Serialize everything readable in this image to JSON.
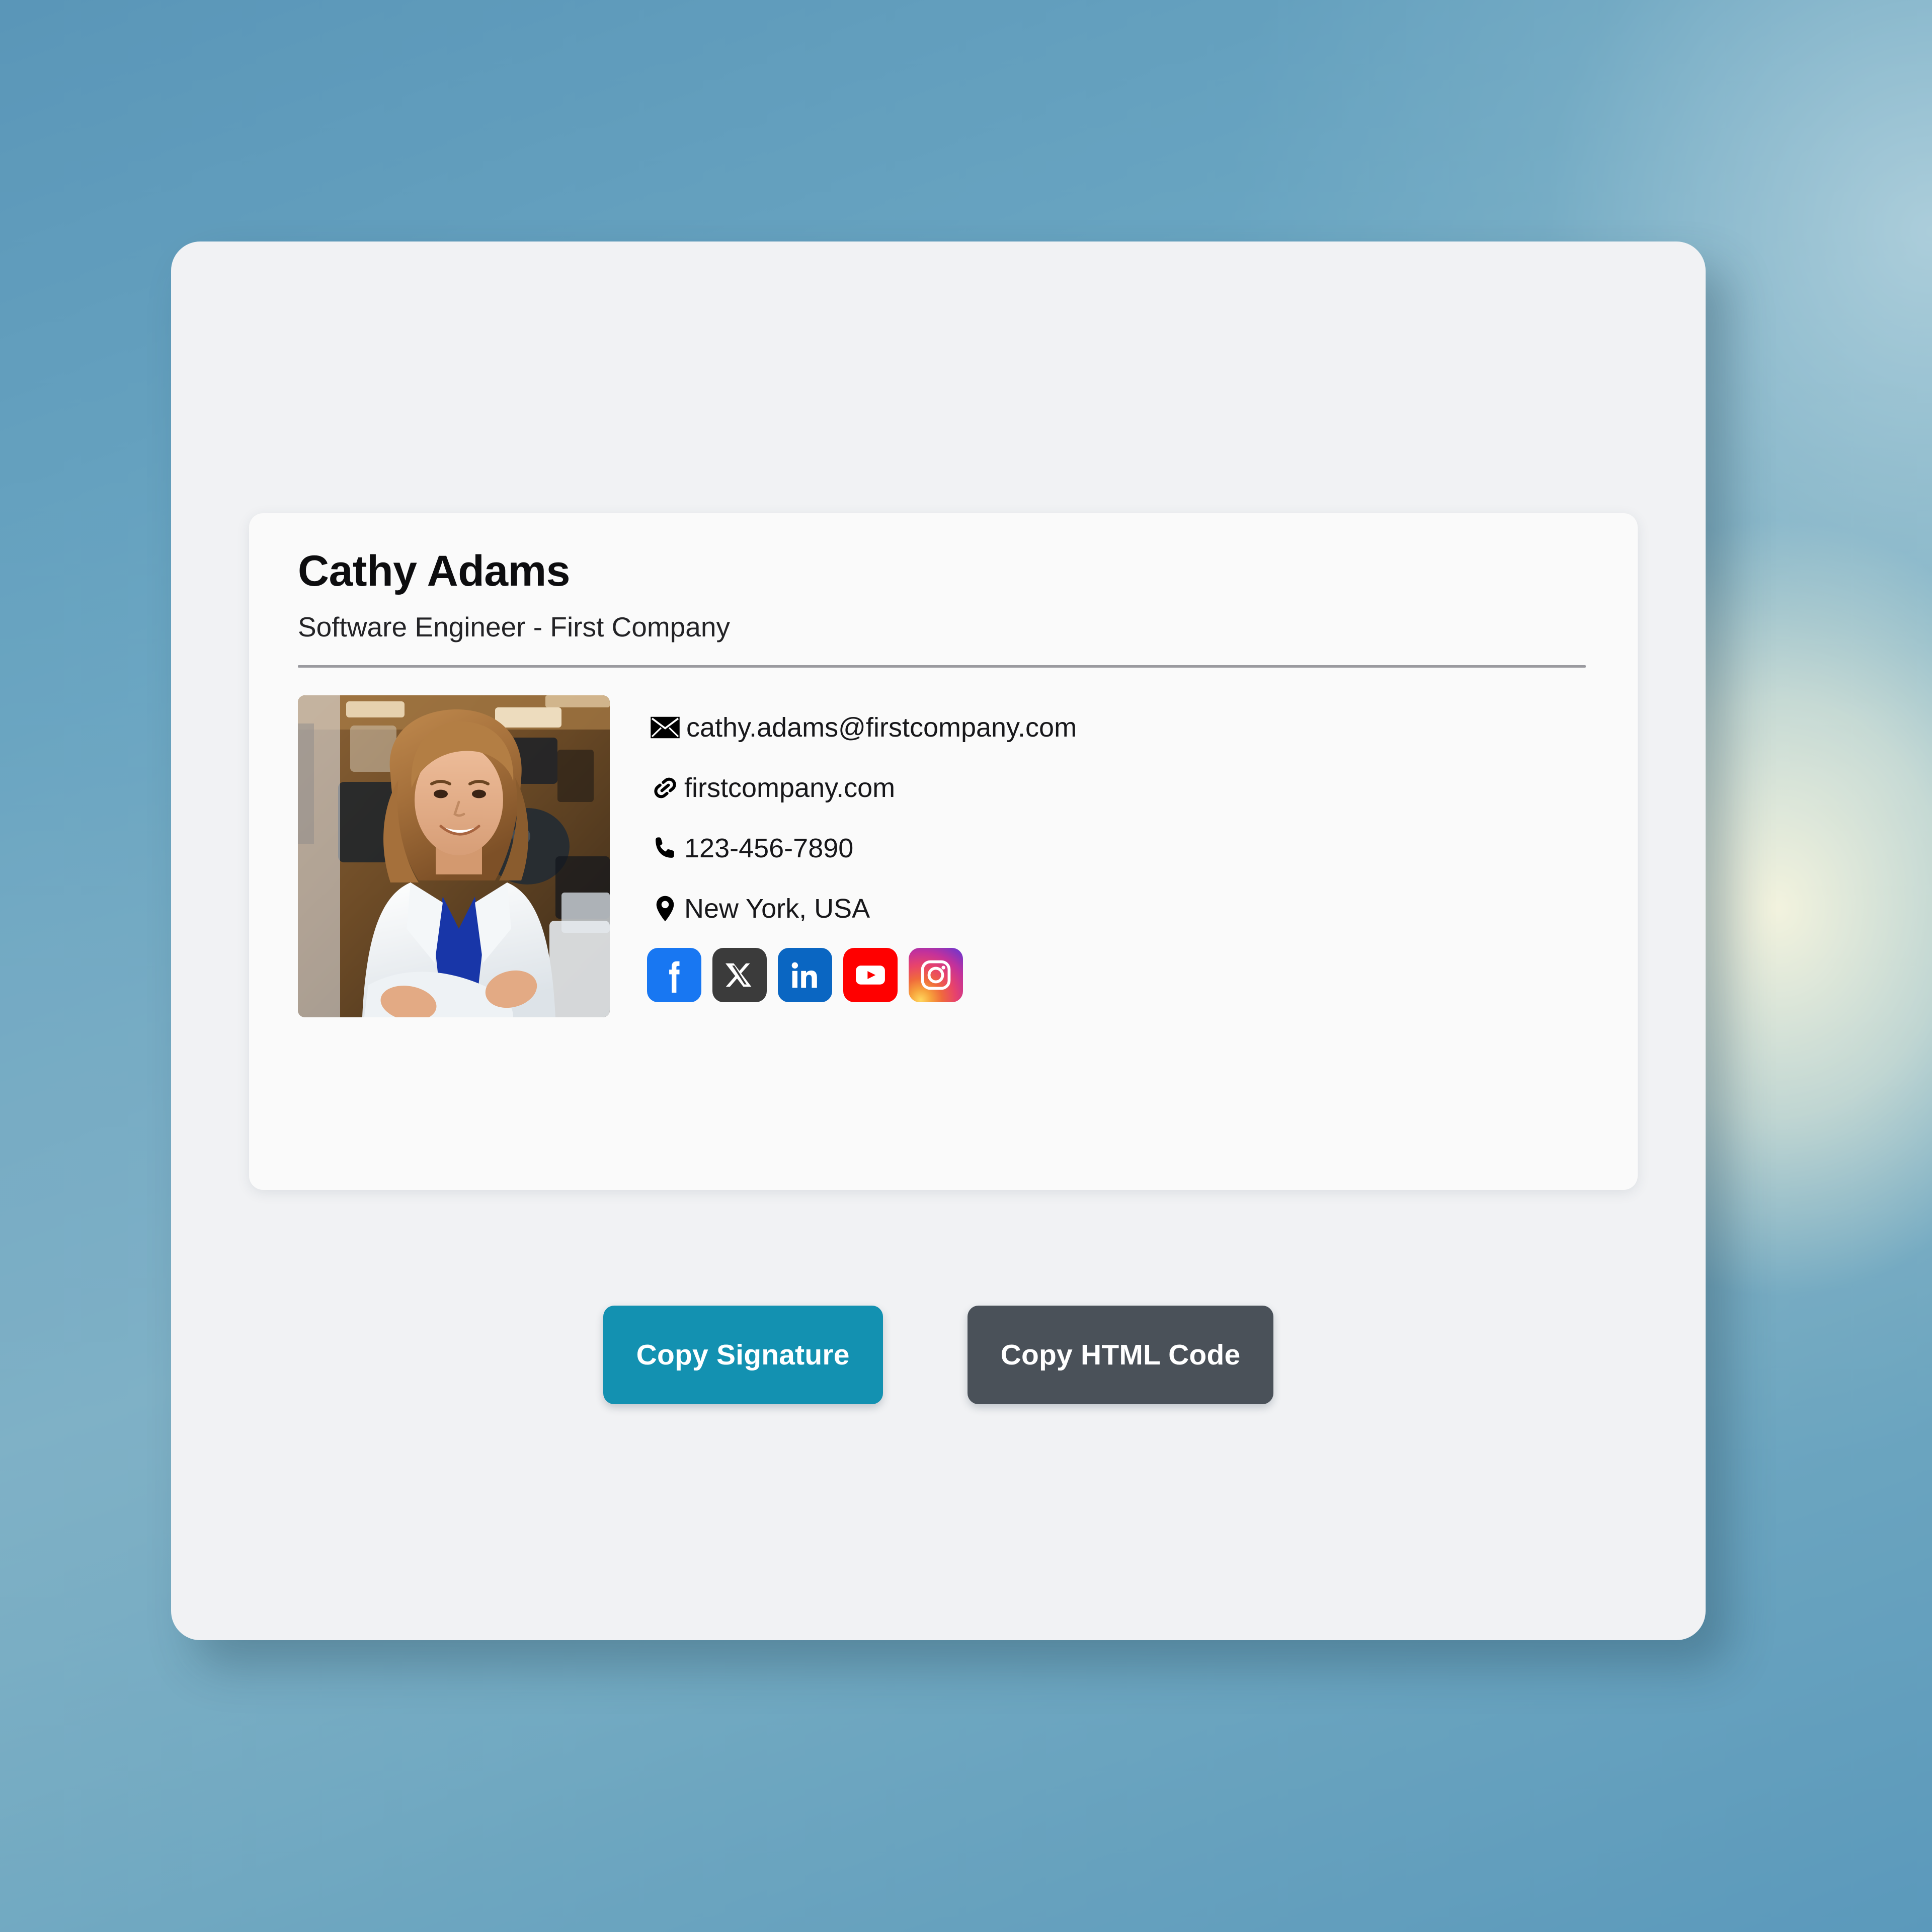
{
  "signature": {
    "name": "Cathy Adams",
    "title": "Software Engineer - First Company",
    "photo": {
      "alt": "Portrait of Cathy Adams",
      "description": "Smiling woman with shoulder-length light brown hair wearing a white blazer over a blue top, arms crossed, in a blurred office background"
    },
    "contacts": [
      {
        "icon": "envelope-icon",
        "type": "email",
        "value": "cathy.adams@firstcompany.com"
      },
      {
        "icon": "link-icon",
        "type": "website",
        "value": "firstcompany.com"
      },
      {
        "icon": "phone-icon",
        "type": "phone",
        "value": "123-456-7890"
      },
      {
        "icon": "location-pin-icon",
        "type": "location",
        "value": "New York, USA"
      }
    ],
    "social": [
      {
        "icon": "facebook-icon",
        "name": "Facebook",
        "color": "#1877F2"
      },
      {
        "icon": "x-twitter-icon",
        "name": "X",
        "color": "#3B3B3B"
      },
      {
        "icon": "linkedin-icon",
        "name": "LinkedIn",
        "color": "#0A66C2"
      },
      {
        "icon": "youtube-icon",
        "name": "YouTube",
        "color": "#FF0000"
      },
      {
        "icon": "instagram-icon",
        "name": "Instagram",
        "color": "#E8436B"
      }
    ]
  },
  "actions": {
    "copy_signature_label": "Copy Signature",
    "copy_html_label": "Copy HTML Code"
  },
  "theme": {
    "page_background": "#5F9CBD",
    "panel_background": "#F1F2F4",
    "card_background": "#FAFAFA",
    "divider_color": "#9A9A9F",
    "primary_button_color": "#1391B1",
    "secondary_button_color": "#4A5159",
    "text_color": "#17171A"
  }
}
